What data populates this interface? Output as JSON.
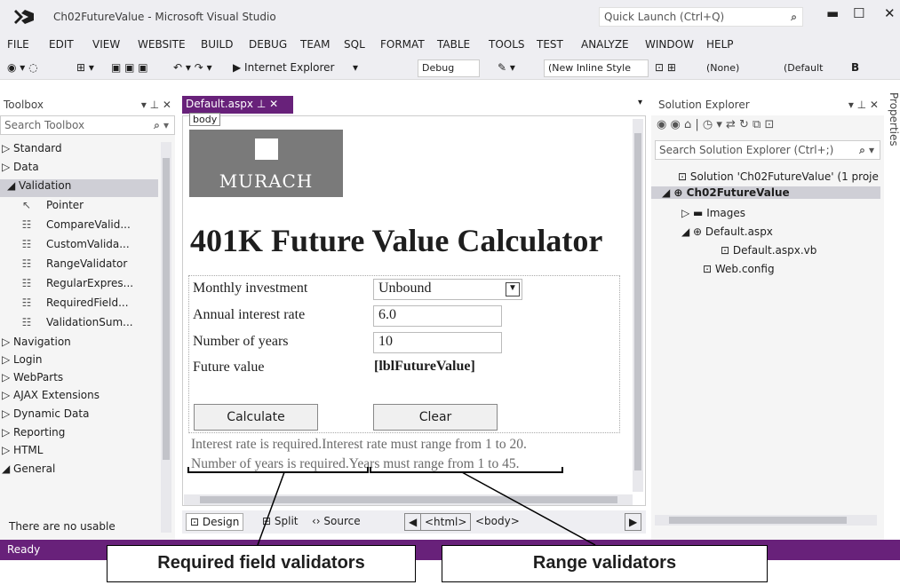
{
  "window": {
    "title": "Ch02FutureValue - Microsoft Visual Studio",
    "quick_launch": "Quick Launch (Ctrl+Q)",
    "search_icon": "search-icon"
  },
  "menu": [
    "FILE",
    "EDIT",
    "VIEW",
    "WEBSITE",
    "BUILD",
    "DEBUG",
    "TEAM",
    "SQL",
    "FORMAT",
    "TABLE",
    "TOOLS",
    "TEST",
    "ANALYZE",
    "WINDOW",
    "HELP"
  ],
  "toolbar": {
    "run_target": "▶ Internet Explorer",
    "config": "Debug",
    "style": "(New Inline Style",
    "target": "(None)",
    "font": "(Default",
    "bold": "B"
  },
  "toolbox": {
    "title": "Toolbox",
    "search": "Search Toolbox",
    "groups_top": [
      "Standard",
      "Data"
    ],
    "validation": "Validation",
    "validation_items": [
      "Pointer",
      "CompareValid...",
      "CustomValida...",
      "RangeValidator",
      "RegularExpres...",
      "RequiredField...",
      "ValidationSum..."
    ],
    "groups_bottom": [
      "Navigation",
      "Login",
      "WebParts",
      "AJAX Extensions",
      "Dynamic Data",
      "Reporting",
      "HTML"
    ],
    "general": "General",
    "empty_text": "There are no usable"
  },
  "document": {
    "tab": "Default.aspx",
    "body_tag": "body",
    "logo_text": "MURACH",
    "heading": "401K Future Value Calculator",
    "rows": [
      {
        "label": "Monthly investment",
        "value": "Unbound"
      },
      {
        "label": "Annual interest rate",
        "value": "6.0"
      },
      {
        "label": "Number of years",
        "value": "10"
      },
      {
        "label": "Future value",
        "value": "[lblFutureValue]"
      }
    ],
    "calculate": "Calculate",
    "clear": "Clear",
    "err_rate_required": "Interest rate is required.",
    "err_rate_range": "Interest rate must range from 1 to 20.",
    "err_years_required": "Number of years is required.",
    "err_years_range": "Years must range from 1 to 45."
  },
  "views": {
    "design": "Design",
    "split": "Split",
    "source": "Source",
    "html": "<html>",
    "body": "<body>"
  },
  "solution_explorer": {
    "title": "Solution Explorer",
    "search": "Search Solution Explorer (Ctrl+;)",
    "solution": "Solution 'Ch02FutureValue' (1 proje",
    "project": "Ch02FutureValue",
    "images": "Images",
    "default_aspx": "Default.aspx",
    "default_vb": "Default.aspx.vb",
    "web_config": "Web.config"
  },
  "properties_tab": "Properties",
  "status": "Ready",
  "callouts": {
    "required": "Required field validators",
    "range": "Range validators"
  },
  "colors": {
    "accent": "#68217a",
    "chrome": "#eeeef2"
  }
}
